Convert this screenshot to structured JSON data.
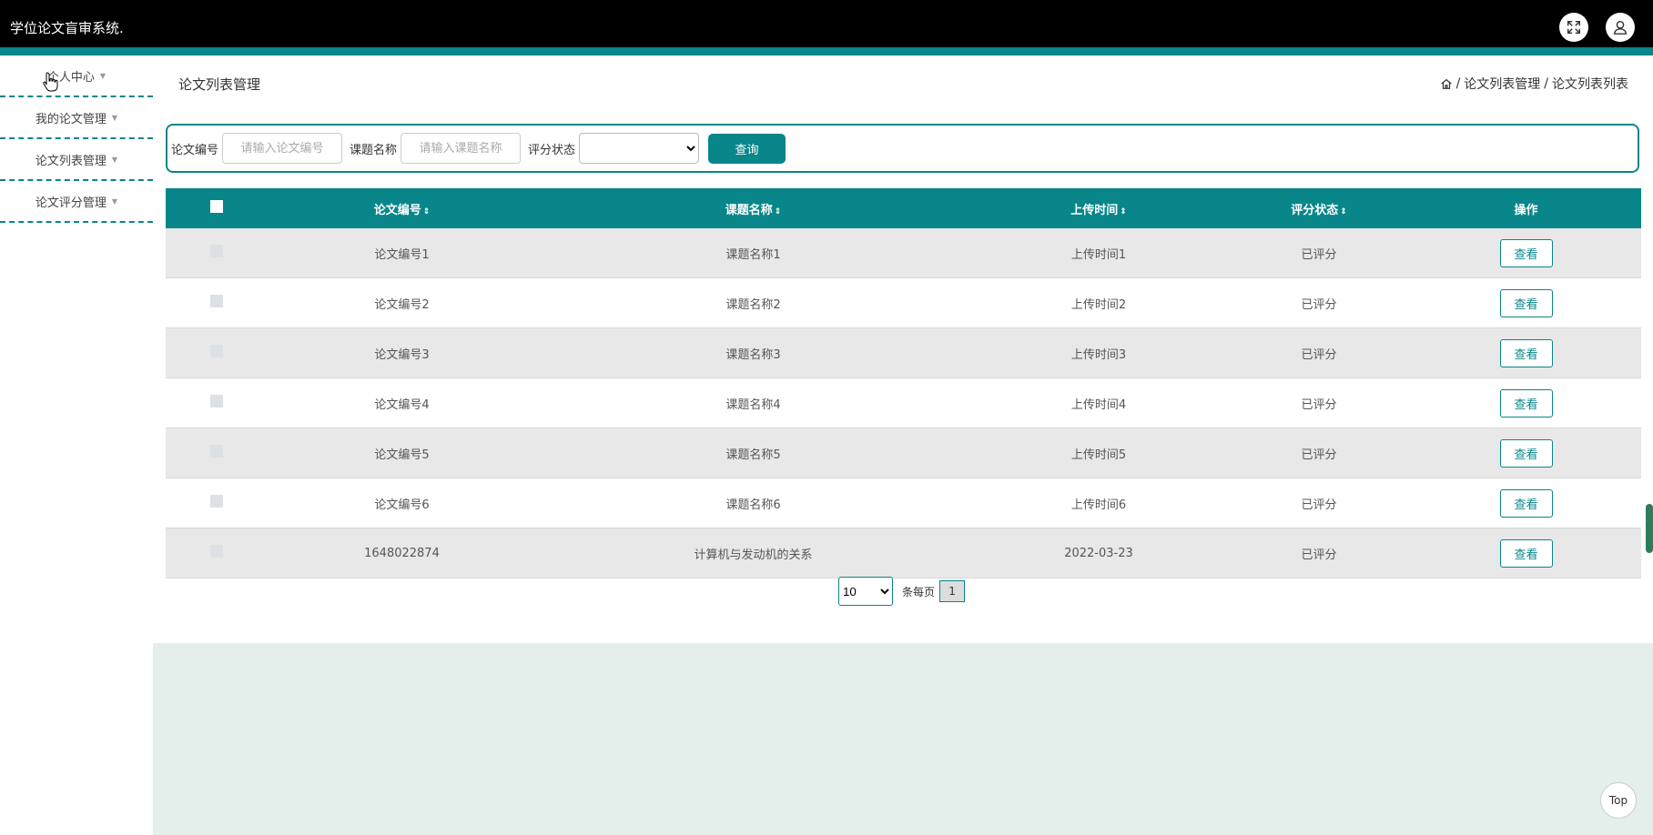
{
  "app": {
    "title": "学位论文盲审系统."
  },
  "header": {
    "fullscreen_icon": "expand-icon",
    "user_icon": "user-icon"
  },
  "sidebar": {
    "items": [
      {
        "label": "个人中心"
      },
      {
        "label": "我的论文管理"
      },
      {
        "label": "论文列表管理"
      },
      {
        "label": "论文评分管理"
      }
    ]
  },
  "page": {
    "title": "论文列表管理",
    "breadcrumb": [
      "论文列表管理",
      "论文列表列表"
    ]
  },
  "search": {
    "paper_no_label": "论文编号",
    "paper_no_placeholder": "请输入论文编号",
    "topic_label": "课题名称",
    "topic_placeholder": "请输入课题名称",
    "status_label": "评分状态",
    "status_value": "",
    "query_button": "查询"
  },
  "table": {
    "headers": [
      "论文编号",
      "课题名称",
      "上传时间",
      "评分状态",
      "操作"
    ],
    "rows": [
      {
        "paper_no": "论文编号1",
        "topic": "课题名称1",
        "upload_time": "上传时间1",
        "status": "已评分",
        "action": "查看"
      },
      {
        "paper_no": "论文编号2",
        "topic": "课题名称2",
        "upload_time": "上传时间2",
        "status": "已评分",
        "action": "查看"
      },
      {
        "paper_no": "论文编号3",
        "topic": "课题名称3",
        "upload_time": "上传时间3",
        "status": "已评分",
        "action": "查看"
      },
      {
        "paper_no": "论文编号4",
        "topic": "课题名称4",
        "upload_time": "上传时间4",
        "status": "已评分",
        "action": "查看"
      },
      {
        "paper_no": "论文编号5",
        "topic": "课题名称5",
        "upload_time": "上传时间5",
        "status": "已评分",
        "action": "查看"
      },
      {
        "paper_no": "论文编号6",
        "topic": "课题名称6",
        "upload_time": "上传时间6",
        "status": "已评分",
        "action": "查看"
      },
      {
        "paper_no": "1648022874",
        "topic": "计算机与发动机的关系",
        "upload_time": "2022-03-23",
        "status": "已评分",
        "action": "查看"
      }
    ]
  },
  "pagination": {
    "page_size": "10",
    "per_page_label": "条每页",
    "current_page": "1"
  },
  "top_button": "Top",
  "colors": {
    "accent": "#08868a",
    "topbar": "#000000",
    "footer": "#e4efec"
  }
}
